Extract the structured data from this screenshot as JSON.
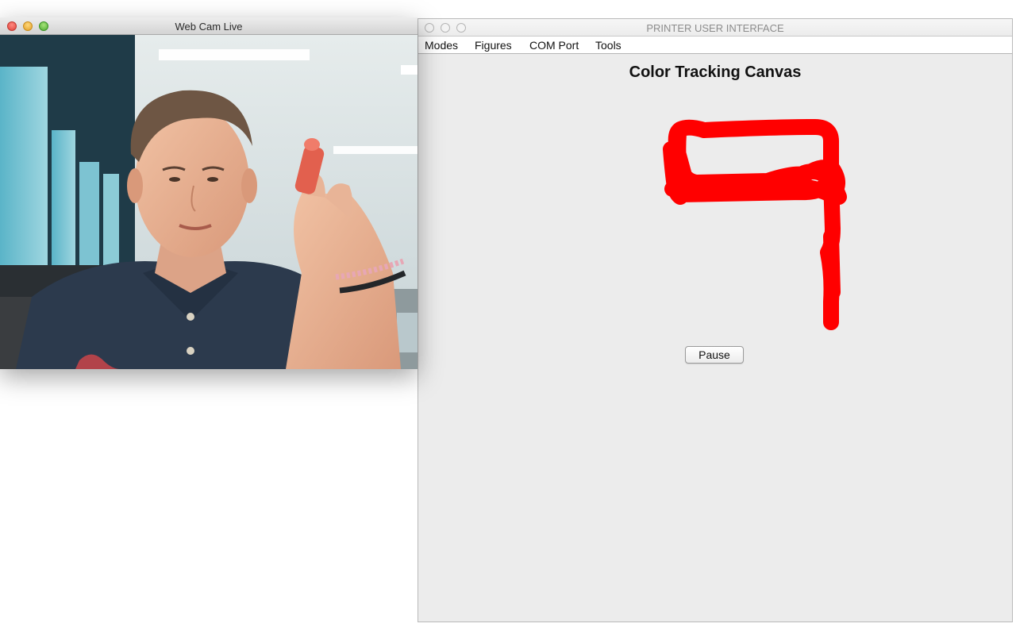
{
  "webcam_window": {
    "title": "Web Cam Live"
  },
  "printer_window": {
    "title": "PRINTER USER INTERFACE",
    "menu": [
      "Modes",
      "Figures",
      "COM Port",
      "Tools"
    ],
    "canvas_title": "Color Tracking Canvas",
    "pause_label": "Pause",
    "stroke_color": "#ff0000"
  },
  "colors": {
    "window_bg": "#ececec",
    "titlebar_active_top": "#ededed",
    "titlebar_active_bottom": "#d3d3d3"
  }
}
